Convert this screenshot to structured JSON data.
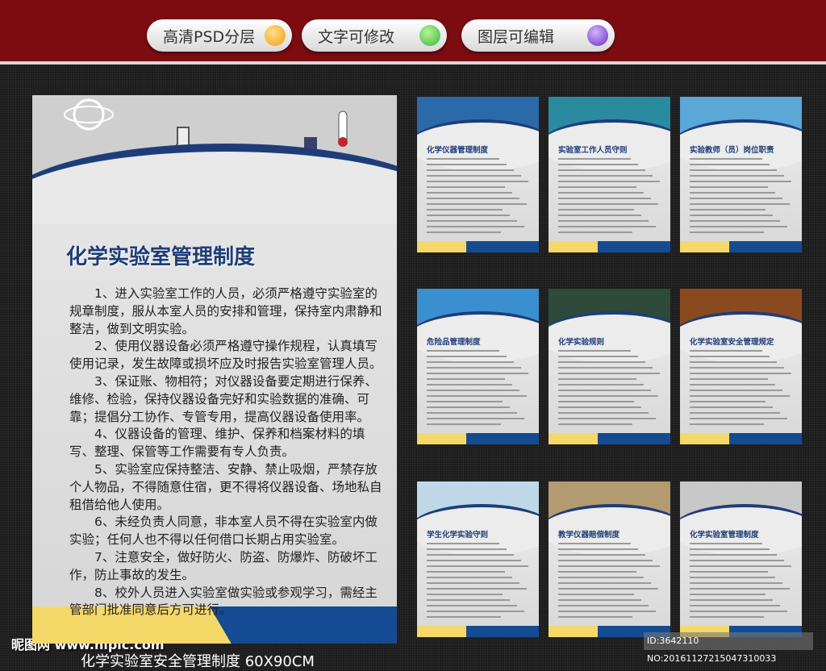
{
  "top_badges": [
    {
      "label": "高清PSD分层",
      "color": "#f39a12"
    },
    {
      "label": "文字可修改",
      "color": "#3bb43a"
    },
    {
      "label": "图层可编辑",
      "color": "#6a2cc0"
    }
  ],
  "main_poster": {
    "title": "化学实验室管理制度",
    "paragraphs": [
      "1、进入实验室工作的人员，必须严格遵守实验室的规章制度，服从本室人员的安排和管理，保持室内肃静和整洁，做到文明实验。",
      "2、使用仪器设备必须严格遵守操作规程，认真填写使用记录，发生故障或损坏应及时报告实验室管理人员。",
      "3、保证账、物相符；对仪器设备要定期进行保养、维修、检验，保持仪器设备完好和实验数据的准确、可靠；提倡分工协作、专管专用，提高仪器设备使用率。",
      "4、仪器设备的管理、维护、保养和档案材料的填写、整理、保管等工作需要有专人负责。",
      "5、实验室应保持整洁、安静、禁止吸烟，严禁存放个人物品，不得随意住宿，更不得将仪器设备、场地私自租借给他人使用。",
      "6、未经负责人同意，非本室人员不得在实验室内做实验；任何人也不得以任何借口长期占用实验室。",
      "7、注意安全，做好防火、防盗、防爆炸、防破坏工作，防止事故的发生。",
      "8、校外人员进入实验室做实验或参观学习，需经主管部门批准同意后方可进行。"
    ]
  },
  "thumbnails": [
    {
      "title": "化学仪器管理制度",
      "color": "#2b6aa8"
    },
    {
      "title": "实验室工作人员守则",
      "color": "#2a8aa0"
    },
    {
      "title": "实验教师（员）岗位职责",
      "color": "#5aa7d8"
    },
    {
      "title": "危险品管理制度",
      "color": "#3a8fd0"
    },
    {
      "title": "化学实验规则",
      "color": "#2d4a3a"
    },
    {
      "title": "化学实验室安全管理规定",
      "color": "#8a4a20"
    },
    {
      "title": "学生化学实验守则",
      "color": "#bfd8e8"
    },
    {
      "title": "教学仪器赔偿制度",
      "color": "#b49a70"
    },
    {
      "title": "化学实验室管理制度",
      "color": "#c8c8c8"
    }
  ],
  "watermark": "昵图网 www.nipic.com",
  "image_id": "ID:3642110 NO:20161127215047310033",
  "caption": "化学实验室安全管理制度 60X90CM"
}
